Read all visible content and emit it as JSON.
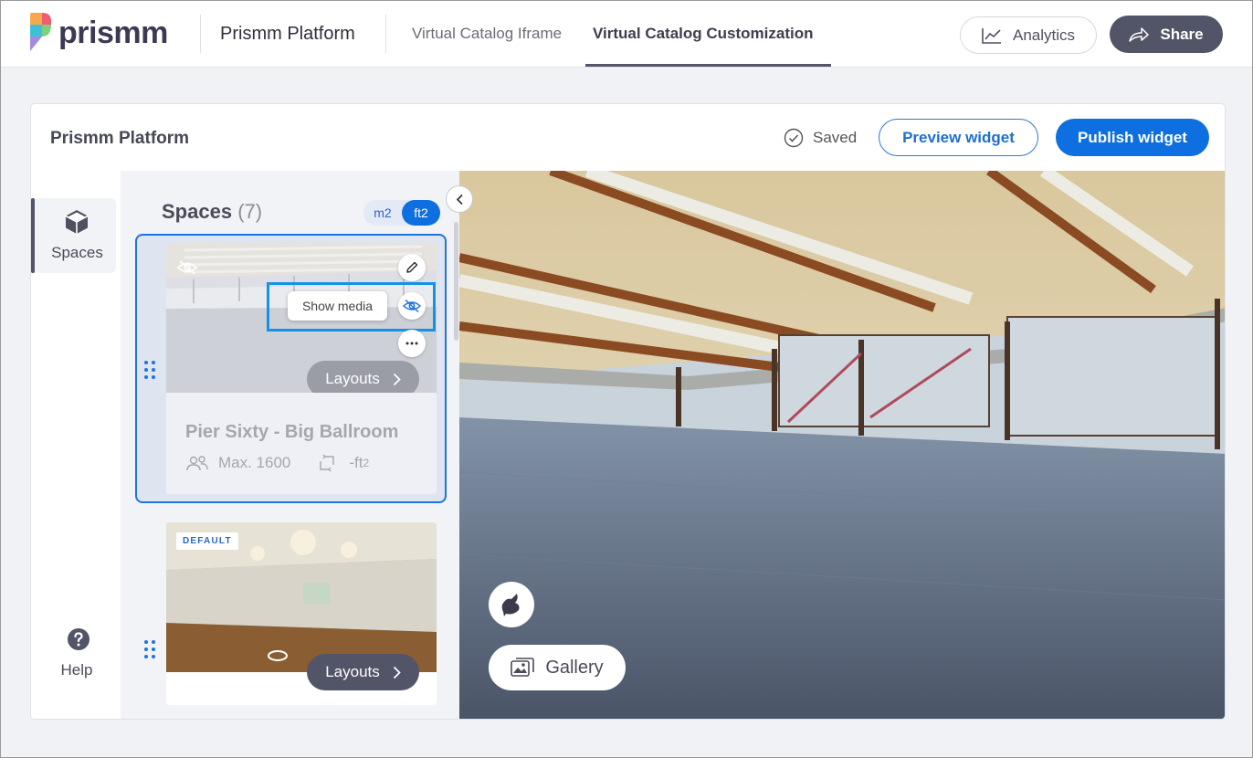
{
  "brand": {
    "name": "prismm"
  },
  "header": {
    "app_name": "Prismm Platform",
    "tabs": [
      {
        "label": "Virtual Catalog Iframe",
        "active": false
      },
      {
        "label": "Virtual Catalog Customization",
        "active": true
      }
    ],
    "analytics_label": "Analytics",
    "share_label": "Share"
  },
  "card": {
    "title": "Prismm Platform",
    "saved_label": "Saved",
    "preview_label": "Preview widget",
    "publish_label": "Publish widget"
  },
  "rail": {
    "items": [
      {
        "label": "Spaces",
        "icon": "cube-icon",
        "active": true
      },
      {
        "label": "Help",
        "icon": "question-icon",
        "active": false
      }
    ]
  },
  "spaces_panel": {
    "title": "Spaces",
    "count": "(7)",
    "units": {
      "options": [
        "m2",
        "ft2"
      ],
      "selected": "ft2"
    },
    "spaces": [
      {
        "name": "Pier Sixty - Big Ballroom",
        "max_capacity": "Max. 1600",
        "area": "-ft",
        "area_unit_sup": "2",
        "layouts_label": "Layouts",
        "tooltip": "Show media",
        "hidden": true,
        "selected": true
      },
      {
        "badge": "DEFAULT",
        "layouts_label": "Layouts"
      }
    ]
  },
  "viewer": {
    "gallery_label": "Gallery"
  },
  "colors": {
    "primary": "#0e6fe0",
    "dark_button": "#525467",
    "panel_bg": "#f2f3f6"
  }
}
